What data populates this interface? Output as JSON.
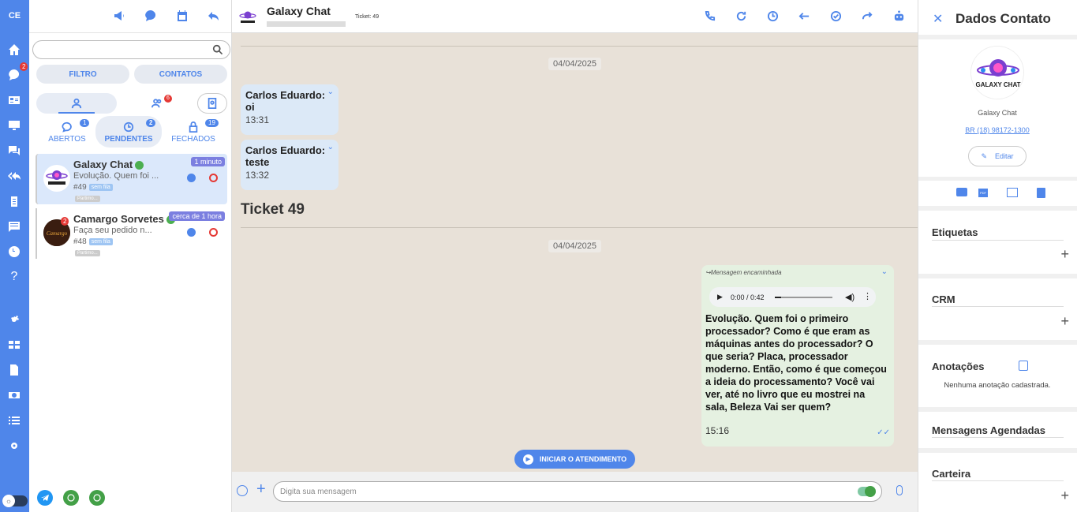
{
  "user": {
    "initials": "CE"
  },
  "rail": {
    "chat_badge": "2"
  },
  "tickets": {
    "search_placeholder": "",
    "filter_label": "FILTRO",
    "contacts_label": "CONTATOS",
    "group_badge": "6",
    "tabs": [
      {
        "label": "ABERTOS",
        "count": "1"
      },
      {
        "label": "PENDENTES",
        "count": "2"
      },
      {
        "label": "FECHADOS",
        "count": "19"
      }
    ],
    "items": [
      {
        "name": "Galaxy Chat",
        "message": "Evolução. Quem foi ...",
        "id": "#49",
        "tag": "sem fila",
        "time": "1 minuto",
        "unread": ""
      },
      {
        "name": "Camargo Sorvetes",
        "message": "Faça seu pedido n...",
        "id": "#48",
        "tag": "sem fila",
        "time": "cerca de 1 hora",
        "unread": "2"
      }
    ]
  },
  "chat": {
    "title": "Galaxy Chat",
    "ticket": "Ticket: 49",
    "dates": [
      "04/04/2025",
      "04/04/2025"
    ],
    "messages": [
      {
        "name": "Carlos Eduardo:",
        "text": "oi",
        "time": "13:31"
      },
      {
        "name": "Carlos Eduardo:",
        "text": "teste",
        "time": "13:32"
      }
    ],
    "ticket_label": "Ticket 49",
    "outgoing": {
      "forwarded": "Mensagem encaminhada",
      "audio_time": "0:00 / 0:42",
      "text": "Evolução. Quem foi o primeiro processador? Como é que eram as máquinas antes do processador? O que seria? Placa, processador moderno. Então, como é que começou a ideia do processamento? Você vai ver, até no livro que eu mostrei na sala, Beleza Vai ser quem?",
      "time": "15:16"
    },
    "start_button": "INICIAR O ATENDIMENTO",
    "compose_placeholder": "Digita sua mensagem"
  },
  "contact": {
    "header": "Dados Contato",
    "logo_text": "GALAXY CHAT",
    "name": "Galaxy Chat",
    "phone": "BR (18) 98172-1300",
    "edit_label": "Editar",
    "sections": {
      "tags": "Etiquetas",
      "crm": "CRM",
      "notes": "Anotações",
      "notes_empty": "Nenhuma anotação cadastrada.",
      "scheduled": "Mensagens Agendadas",
      "wallet": "Carteira"
    }
  }
}
